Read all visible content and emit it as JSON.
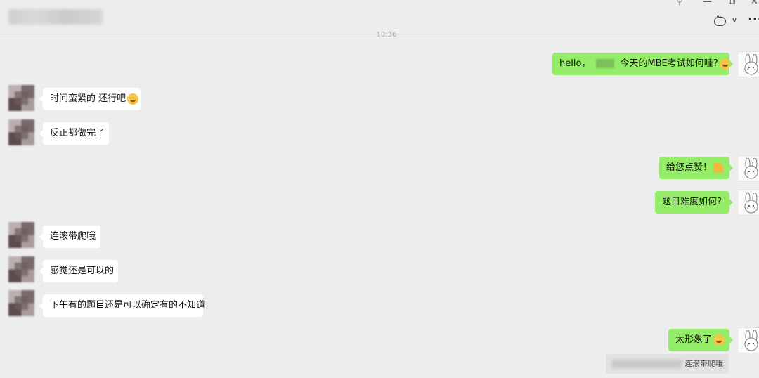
{
  "header": {
    "time": "10:36",
    "icons": [
      "pin-icon",
      "minimize-icon",
      "maximize-icon",
      "close-icon",
      "chat-icon",
      "chevron-down-icon",
      "more-icon"
    ],
    "pin_glyph": "⚲",
    "min_glyph": "—",
    "max_glyph": "⧉",
    "close_glyph": "✕",
    "chevron_glyph": "∨",
    "more_glyph": "···"
  },
  "messages": [
    {
      "side": "right",
      "text_a": "hello，",
      "text_b": "今天的MBE考试如何哇?",
      "emoji": "smile"
    },
    {
      "side": "left",
      "text": "时间蛮紧的 还行吧",
      "emoji": "smile"
    },
    {
      "side": "left",
      "text": "反正都做完了"
    },
    {
      "side": "right",
      "text": "给您点赞！",
      "emoji": "thumbs-up"
    },
    {
      "side": "right",
      "text": "题目难度如何?"
    },
    {
      "side": "left",
      "text": "连滚带爬哦"
    },
    {
      "side": "left",
      "text": "感觉还是可以的"
    },
    {
      "side": "left",
      "text": "下午有的题目还是可以确定有的不知道"
    },
    {
      "side": "right",
      "text": "太形象了",
      "emoji": "laugh"
    }
  ],
  "quote": {
    "text": "连滚带爬哦"
  },
  "colors": {
    "bubble_self": "#95ec69",
    "bubble_other": "#ffffff",
    "background": "#ededed"
  }
}
